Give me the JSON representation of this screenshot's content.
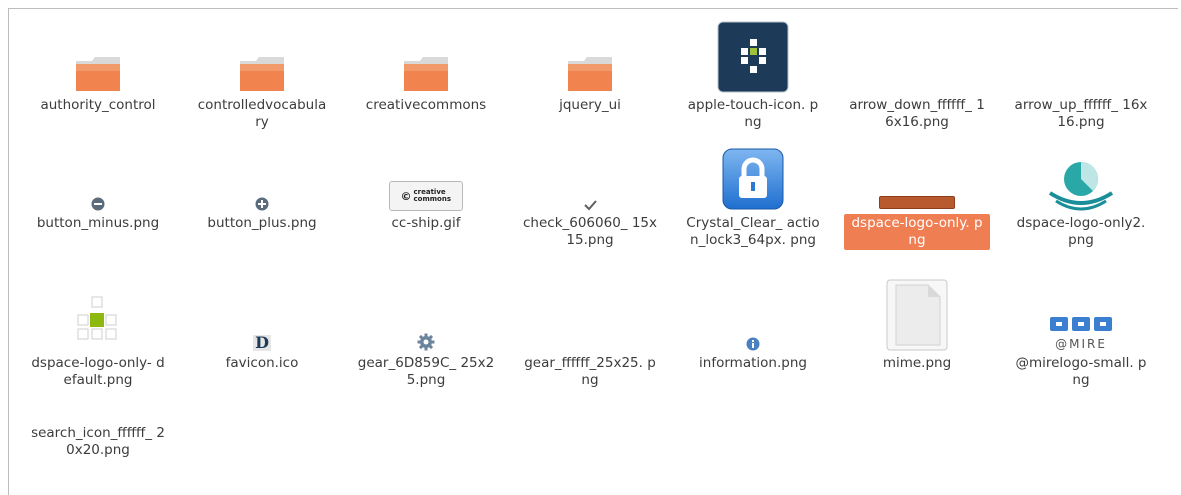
{
  "files": [
    {
      "name": "authority_control",
      "icon": "folder-icon"
    },
    {
      "name": "controlledvocabula ry",
      "icon": "folder-icon"
    },
    {
      "name": "creativecommons",
      "icon": "folder-icon"
    },
    {
      "name": "jquery_ui",
      "icon": "folder-icon"
    },
    {
      "name": "apple-touch-icon. png",
      "icon": "dspace-logo-icon"
    },
    {
      "name": "arrow_down_ffffff_ 16x16.png",
      "icon": "blank-icon"
    },
    {
      "name": "arrow_up_ffffff_ 16x16.png",
      "icon": "blank-icon"
    },
    {
      "name": "button_minus.png",
      "icon": "minus-circle-icon"
    },
    {
      "name": "button_plus.png",
      "icon": "plus-circle-icon"
    },
    {
      "name": "cc-ship.gif",
      "icon": "creative-commons-badge-icon",
      "badge_text": "creative commons"
    },
    {
      "name": "check_606060_ 15x15.png",
      "icon": "checkmark-icon"
    },
    {
      "name": "Crystal_Clear_ action_lock3_64px. png",
      "icon": "lock-icon"
    },
    {
      "name": "dspace-logo-only. png",
      "icon": "bar-icon",
      "selected": true
    },
    {
      "name": "dspace-logo-only2. png",
      "icon": "dspace-logo2-icon"
    },
    {
      "name": "dspace-logo-only- default.png",
      "icon": "squares-logo-icon"
    },
    {
      "name": "favicon.ico",
      "icon": "favicon-d-icon",
      "glyph": "D"
    },
    {
      "name": "gear_6D859C_ 25x25.png",
      "icon": "gear-icon"
    },
    {
      "name": "gear_ffffff_25x25. png",
      "icon": "blank-icon"
    },
    {
      "name": "information.png",
      "icon": "info-icon"
    },
    {
      "name": "mime.png",
      "icon": "document-icon"
    },
    {
      "name": "@mirelogo-small. png",
      "icon": "mire-logo-icon",
      "badge_text": "@MIRE"
    },
    {
      "name": "search_icon_ffffff_ 20x20.png",
      "icon": "blank-icon"
    }
  ],
  "colors": {
    "folder": "#f1834f",
    "selection": "#f07e53",
    "text": "#3c3c3c"
  }
}
